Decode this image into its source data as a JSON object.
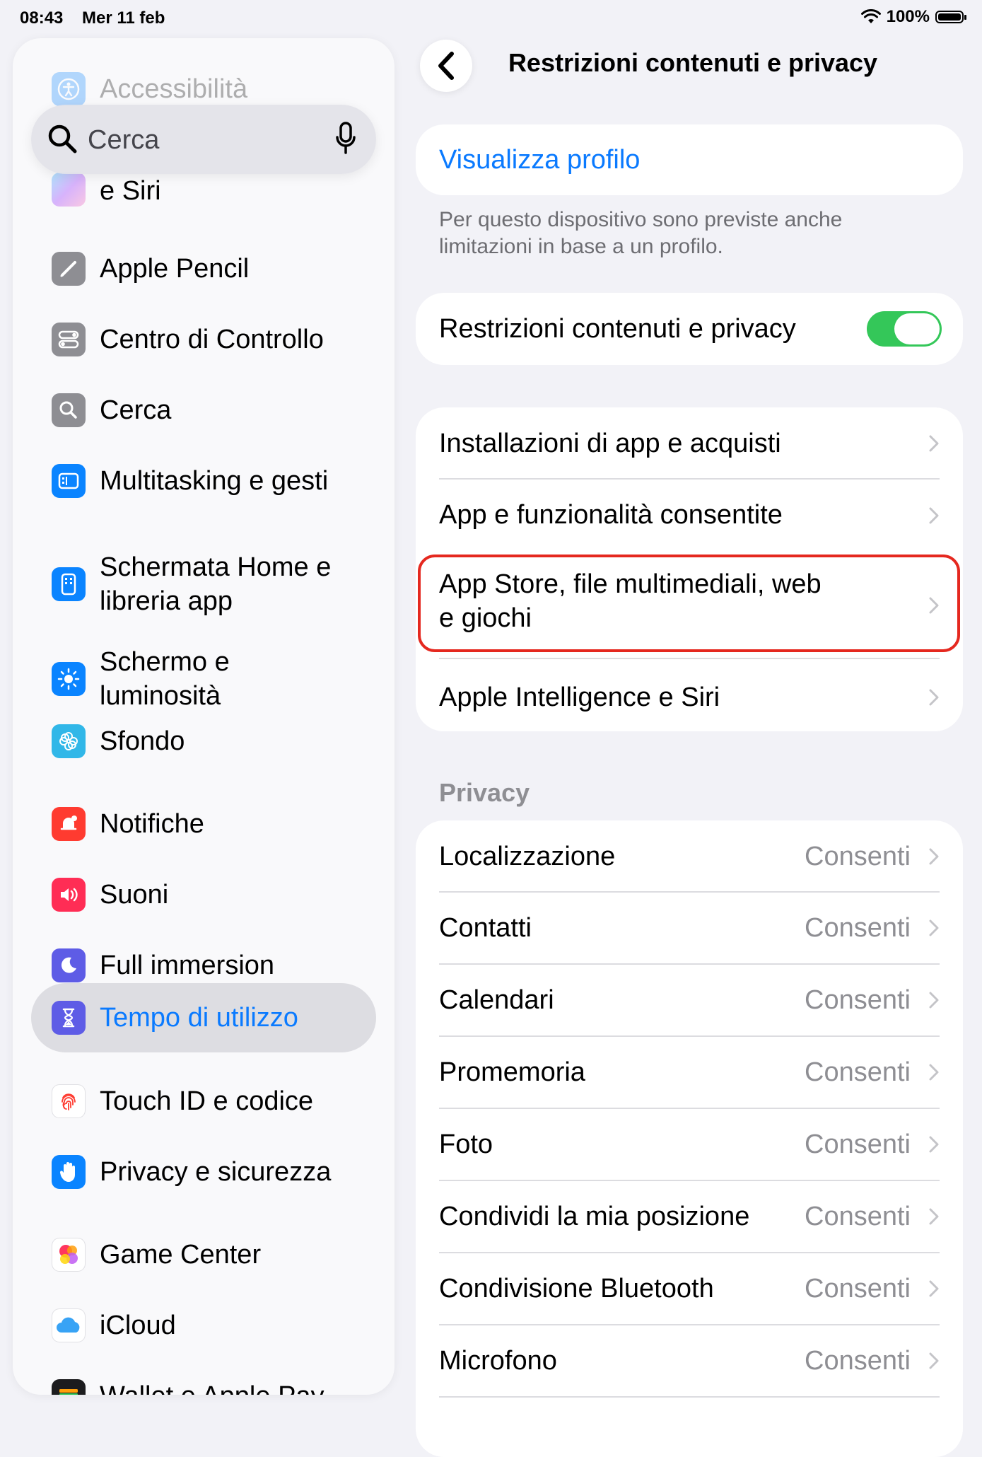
{
  "status_bar": {
    "time": "08:43",
    "date": "Mer 11 feb",
    "battery": "100%"
  },
  "sidebar": {
    "search_placeholder": "Cerca",
    "items": [
      {
        "label": "Accessibilità",
        "icon": "accessibility-icon",
        "color": "#0a84ff"
      },
      {
        "label": "e Siri",
        "icon": "apple-intelligence-siri-icon",
        "color": "#a78bfa"
      },
      {
        "label": "Apple Pencil",
        "icon": "pencil-icon",
        "color": "#8e8e93"
      },
      {
        "label": "Centro di Controllo",
        "icon": "control-center-icon",
        "color": "#8e8e93"
      },
      {
        "label": "Cerca",
        "icon": "search-icon",
        "color": "#8e8e93"
      },
      {
        "label": "Multitasking e gesti",
        "icon": "multitasking-icon",
        "color": "#0a84ff"
      },
      {
        "label": "Schermata Home e\nlibreria app",
        "icon": "home-screen-icon",
        "color": "#0a84ff"
      },
      {
        "label": "Schermo e\nluminosità",
        "icon": "brightness-icon",
        "color": "#0a84ff"
      },
      {
        "label": "Sfondo",
        "icon": "wallpaper-icon",
        "color": "#31b7e8"
      },
      {
        "label": "Notifiche",
        "icon": "notifications-icon",
        "color": "#ff3b30"
      },
      {
        "label": "Suoni",
        "icon": "sounds-icon",
        "color": "#ff2d55"
      },
      {
        "label": "Full immersion",
        "icon": "focus-moon-icon",
        "color": "#5e5ce6"
      },
      {
        "label": "Tempo di utilizzo",
        "icon": "hourglass-icon",
        "color": "#5e5ce6"
      },
      {
        "label": "Touch ID e codice",
        "icon": "fingerprint-icon",
        "color": "#ff3b30"
      },
      {
        "label": "Privacy e sicurezza",
        "icon": "hand-icon",
        "color": "#0a84ff"
      },
      {
        "label": "Game Center",
        "icon": "game-center-icon",
        "color": "#ff375f"
      },
      {
        "label": "iCloud",
        "icon": "icloud-icon",
        "color": "#0a84ff"
      },
      {
        "label": "Wallet e Apple Pay",
        "icon": "wallet-icon",
        "color": "#1c1c1e"
      }
    ]
  },
  "main": {
    "title": "Restrizioni contenuti e privacy",
    "profile_link": "Visualizza profilo",
    "profile_note": "Per questo dispositivo sono previste anche limitazioni in base a un profilo.",
    "toggle_label": "Restrizioni contenuti e privacy",
    "toggle_on": true,
    "group_rows": [
      "Installazioni di app e acquisti",
      "App e funzionalità consentite",
      "App Store, file multimediali, web\ne giochi",
      "Apple Intelligence e Siri"
    ],
    "privacy_header": "Privacy",
    "privacy_rows": [
      {
        "label": "Localizzazione",
        "value": "Consenti"
      },
      {
        "label": "Contatti",
        "value": "Consenti"
      },
      {
        "label": "Calendari",
        "value": "Consenti"
      },
      {
        "label": "Promemoria",
        "value": "Consenti"
      },
      {
        "label": "Foto",
        "value": "Consenti"
      },
      {
        "label": "Condividi la mia posizione",
        "value": "Consenti"
      },
      {
        "label": "Condivisione Bluetooth",
        "value": "Consenti"
      },
      {
        "label": "Microfono",
        "value": "Consenti"
      }
    ]
  },
  "colors": {
    "accent": "#0a7aff",
    "toggle_on": "#34c759",
    "highlight": "#e5281f",
    "background": "#f2f2f7"
  }
}
